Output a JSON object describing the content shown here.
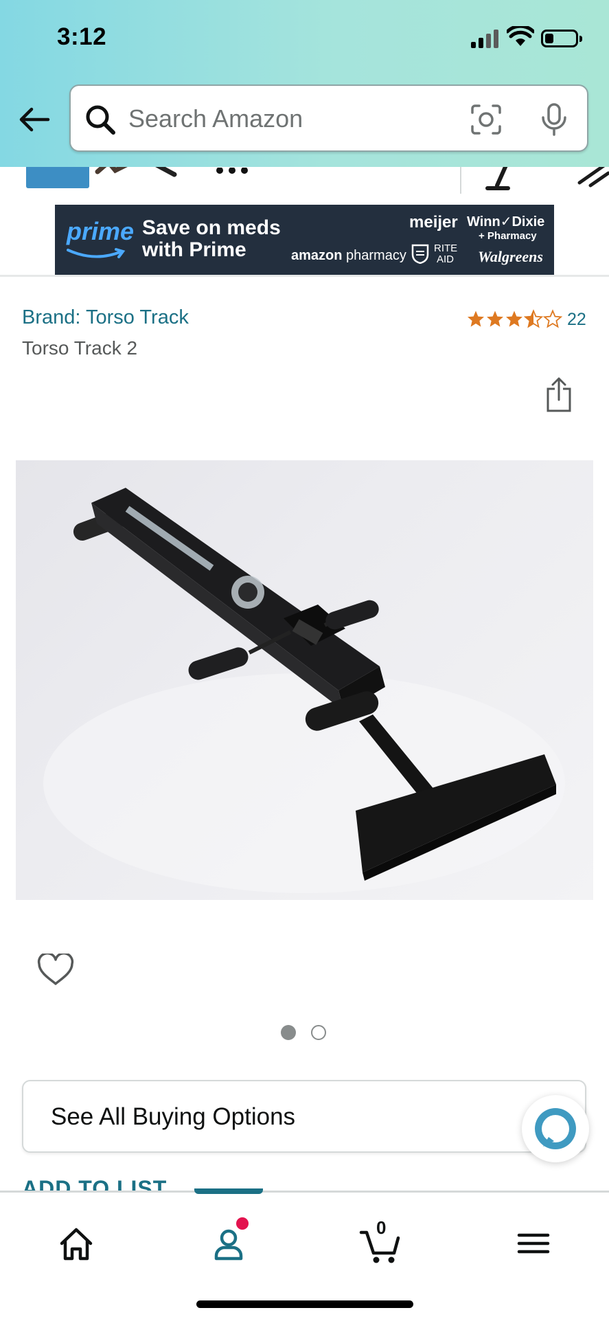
{
  "status_bar": {
    "time": "3:12"
  },
  "header": {
    "search": {
      "placeholder": "Search Amazon",
      "value": ""
    }
  },
  "banner": {
    "prime_word": "prime",
    "line1": "Save on meds",
    "line2": "with Prime",
    "partners": {
      "meijer": "meijer",
      "winn_dixie": "Winn✓Dixie",
      "winn_pharmacy": "+ Pharmacy",
      "amazon_bold": "amazon",
      "amazon_rest": " pharmacy",
      "rite_aid_line1": "RITE",
      "rite_aid_line2": "AID",
      "walgreens": "Walgreens"
    }
  },
  "product": {
    "brand_link": "Brand: Torso Track",
    "title": "Torso Track 2",
    "rating_value": 3.5,
    "rating_out_of": 5,
    "rating_count": "22",
    "image_count": 2,
    "image_index": 1
  },
  "actions": {
    "see_all_buying_options": "See All Buying Options",
    "add_to_list": "ADD TO LIST"
  },
  "bottom_nav": {
    "items": [
      {
        "icon": "home-icon"
      },
      {
        "icon": "account-icon",
        "active": true,
        "notification": true
      },
      {
        "icon": "cart-icon",
        "count": "0"
      },
      {
        "icon": "menu-icon"
      }
    ]
  },
  "colors": {
    "link": "#1b7085",
    "star": "#de7921",
    "banner_bg": "#232f3e",
    "prime_blue": "#4ba9ff",
    "notification": "#e3134e"
  }
}
